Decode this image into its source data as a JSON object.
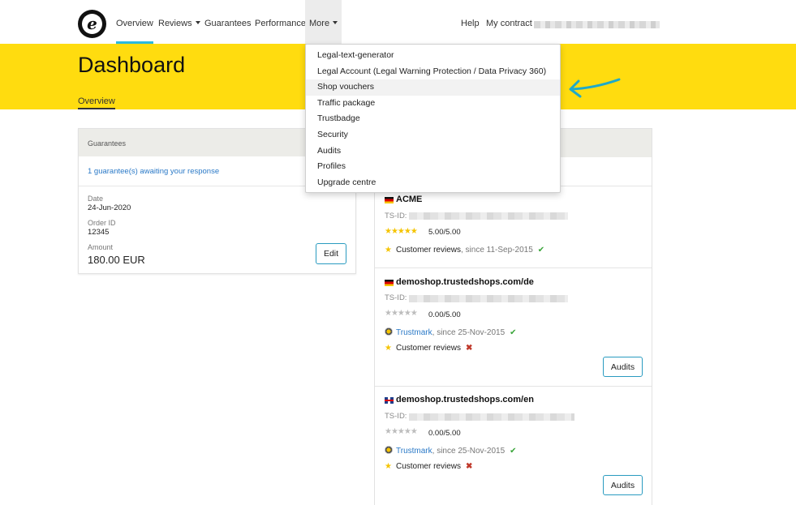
{
  "nav": {
    "overview": "Overview",
    "reviews": "Reviews",
    "guarantees": "Guarantees",
    "performance": "Performance",
    "more": "More",
    "help": "Help",
    "my_contract": "My contract"
  },
  "header": {
    "title": "Dashboard",
    "subtab": "Overview"
  },
  "more_menu": {
    "items": [
      "Legal-text-generator",
      "Legal Account (Legal Warning Protection / Data Privacy 360)",
      "Shop vouchers",
      "Traffic package",
      "Trustbadge",
      "Security",
      "Audits",
      "Profiles",
      "Upgrade centre"
    ],
    "highlighted": "Shop vouchers"
  },
  "guarantees_card": {
    "title": "Guarantees",
    "awaiting_link": "1 guarantee(s) awaiting your response",
    "date_label": "Date",
    "date_value": "24-Jun-2020",
    "order_label": "Order ID",
    "order_value": "12345",
    "amount_label": "Amount",
    "amount_value": "180.00 EUR",
    "edit_label": "Edit"
  },
  "shops": [
    {
      "flag": "flag-de",
      "name": "ACME",
      "tsid_label": "TS-ID:",
      "stars": "★★★★★",
      "stars_filled": 5,
      "rating": "5.00/5.00",
      "reviews_label": "Customer reviews",
      "reviews_since": ", since 11-Sep-2015",
      "reviews_status": "✔"
    },
    {
      "flag": "flag-de",
      "name": "demoshop.trustedshops.com/de",
      "tsid_label": "TS-ID:",
      "stars": "★★★★★",
      "stars_filled": 0,
      "rating": "0.00/5.00",
      "trustmark_label": "Trustmark",
      "trustmark_since": ", since 25-Nov-2015",
      "trustmark_status": "✔",
      "reviews_label": "Customer reviews",
      "reviews_status": "✖",
      "audits_label": "Audits"
    },
    {
      "flag": "flag-uk",
      "name": "demoshop.trustedshops.com/en",
      "tsid_label": "TS-ID:",
      "stars": "★★★★★",
      "stars_filled": 0,
      "rating": "0.00/5.00",
      "trustmark_label": "Trustmark",
      "trustmark_since": ", since 25-Nov-2015",
      "trustmark_status": "✔",
      "reviews_label": "Customer reviews",
      "reviews_status": "✖",
      "audits_label": "Audits"
    }
  ],
  "colors": {
    "accent": "#2ab9de",
    "band": "#ffdc0f",
    "link": "#2a79c7",
    "star": "#f5c400"
  }
}
